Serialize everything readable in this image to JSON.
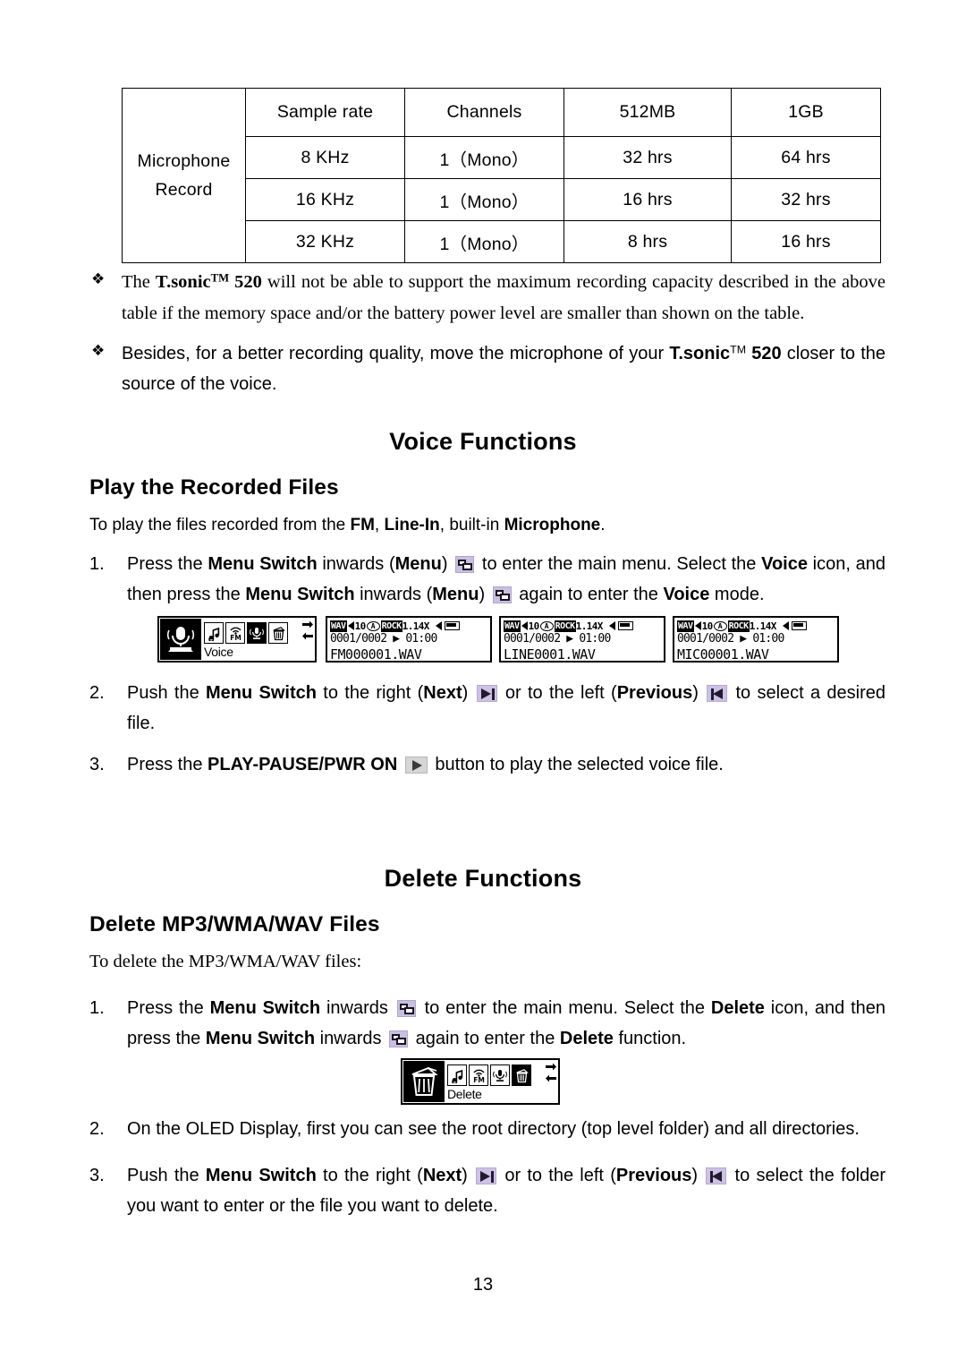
{
  "table": {
    "row_header": "Microphone\nRecord",
    "row_header_line1": "Microphone",
    "row_header_line2": "Record",
    "columns": [
      "",
      "Sample rate",
      "Channels",
      "512MB",
      "1GB"
    ],
    "rows": [
      [
        "8 KHz",
        "1（Mono）",
        "32 hrs",
        "64 hrs"
      ],
      [
        "16 KHz",
        "1（Mono）",
        "16 hrs",
        "32 hrs"
      ],
      [
        "32 KHz",
        "1（Mono）",
        "8 hrs",
        "16 hrs"
      ]
    ]
  },
  "bullets": {
    "marker": "❖",
    "items": [
      {
        "pre": "The ",
        "bold1": "T.sonic",
        "tm": "TM",
        "bold2": " 520",
        "rest": " will not be able to support the maximum recording capacity described in the above table if the memory space and/or the battery power level are smaller than shown on the table."
      },
      {
        "pre": "Besides, for a better recording quality, move the microphone of your ",
        "bold1": "T.sonic",
        "tm": "TM",
        "bold2": " 520",
        "rest": " closer to the source of the voice."
      }
    ]
  },
  "voice_section": {
    "title": "Voice Functions",
    "subtitle": "Play the Recorded Files",
    "intro": {
      "pre": "To play the files recorded from the ",
      "b1": "FM",
      "mid1": ", ",
      "b2": "Line-In",
      "mid2": ", built-in ",
      "b3": "Microphone",
      "end": "."
    },
    "steps": [
      {
        "num": "1.",
        "p1": "Press the ",
        "b1": "Menu Switch",
        "p2": " inwards (",
        "b2": "Menu",
        "p3": ") ",
        "icon1": "menu-icon",
        "p4": " to enter the main menu. Select the ",
        "b3": "Voice",
        "p5": " icon, and then press the ",
        "b4": "Menu Switch",
        "p6": " inwards (",
        "b5": "Menu",
        "p7": ") ",
        "icon2": "menu-icon",
        "p8": " again to enter the ",
        "b6": "Voice",
        "p9": " mode."
      },
      {
        "num": "2.",
        "p1": "Push the ",
        "b1": "Menu Switch",
        "p2": " to the right (",
        "b2": "Next",
        "p3": ") ",
        "icon1": "next-icon",
        "p4": " or to the left (",
        "b3": "Previous",
        "p5": ") ",
        "icon2": "previous-icon",
        "p6": " to select a desired file."
      },
      {
        "num": "3.",
        "p1": "Press the ",
        "b1": "PLAY-PAUSE/PWR ON",
        "p2": " ",
        "icon1": "play-icon",
        "p3": " button to play the selected voice file."
      }
    ],
    "oled_menu": {
      "label": "Voice",
      "selected_icon": "microphone-icon",
      "strip_icons": [
        "music-note-icon",
        "fm-radio-icon",
        "microphone-icon",
        "trash-icon"
      ],
      "strip_selected_index": 2,
      "scroll_icons": [
        "arrow-right-icon",
        "arrow-left-icon"
      ]
    },
    "oled_files": [
      {
        "format": "WAV",
        "volume": "10",
        "repeat": "A",
        "eq": "ROCK",
        "speed": "1.14X",
        "battery": "battery-icon",
        "track": "0001/0002",
        "state": "▶",
        "time": "01:00",
        "filename": "FM000001.WAV"
      },
      {
        "format": "WAV",
        "volume": "10",
        "repeat": "A",
        "eq": "ROCK",
        "speed": "1.14X",
        "battery": "battery-icon",
        "track": "0001/0002",
        "state": "▶",
        "time": "01:00",
        "filename": "LINE0001.WAV"
      },
      {
        "format": "WAV",
        "volume": "10",
        "repeat": "A",
        "eq": "ROCK",
        "speed": "1.14X",
        "battery": "battery-icon",
        "track": "0001/0002",
        "state": "▶",
        "time": "01:00",
        "filename": "MIC00001.WAV"
      }
    ]
  },
  "delete_section": {
    "title": "Delete Functions",
    "subtitle": "Delete MP3/WMA/WAV Files",
    "intro": "To delete the MP3/WMA/WAV files:",
    "steps": [
      {
        "num": "1.",
        "p1": "Press the ",
        "b1": "Menu Switch",
        "p2": " inwards ",
        "icon1": "menu-icon",
        "p3": " to enter the main menu. Select the ",
        "b2": "Delete",
        "p4": " icon, and then press the ",
        "b3": "Menu Switch",
        "p5": " inwards ",
        "icon2": "menu-icon",
        "p6": " again to enter the ",
        "b4": "Delete",
        "p7": " function."
      },
      {
        "num": "2.",
        "p1": "On the OLED Display, first you can see the root directory (top level folder) and all directories."
      },
      {
        "num": "3.",
        "p1": "Push the ",
        "b1": "Menu Switch",
        "p2": " to the right (",
        "b2": "Next",
        "p3": ") ",
        "icon1": "next-icon",
        "p4": " or to the left (",
        "b3": "Previous",
        "p5": ") ",
        "icon2": "previous-icon",
        "p6": " to select the folder you want to enter or the file you want to delete."
      }
    ],
    "oled_menu": {
      "label": "Delete",
      "selected_icon": "trash-icon",
      "strip_icons": [
        "music-note-icon",
        "fm-radio-icon",
        "microphone-icon",
        "trash-icon"
      ],
      "strip_selected_index": 3,
      "scroll_icons": [
        "arrow-right-icon",
        "arrow-left-icon"
      ]
    }
  },
  "footer": {
    "page_number": "13"
  }
}
